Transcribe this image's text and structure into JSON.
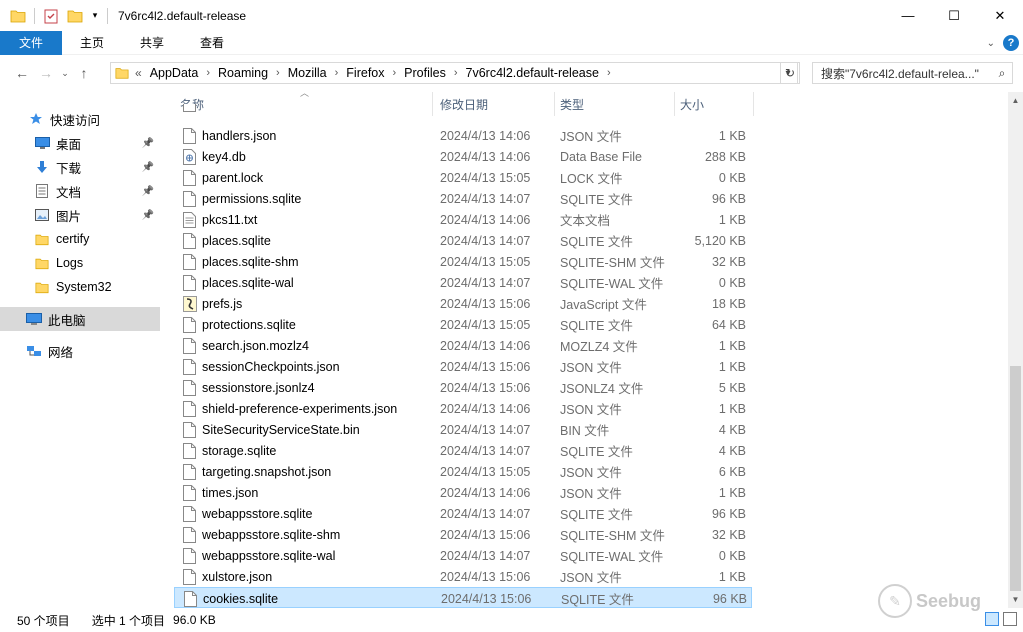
{
  "window": {
    "title": "7v6rc4l2.default-release",
    "minimize": "—",
    "maximize": "☐",
    "close": "✕"
  },
  "ribbon": {
    "tabs": [
      {
        "label": "文件"
      },
      {
        "label": "主页"
      },
      {
        "label": "共享"
      },
      {
        "label": "查看"
      }
    ],
    "help": "?"
  },
  "nav": {
    "breadcrumb": [
      "AppData",
      "Roaming",
      "Mozilla",
      "Firefox",
      "Profiles",
      "7v6rc4l2.default-release"
    ],
    "overflow": "«",
    "search_placeholder": "搜索\"7v6rc4l2.default-relea...\""
  },
  "sidebar": {
    "items": [
      {
        "label": "快速访问",
        "icon": "star-icon"
      },
      {
        "label": "桌面",
        "icon": "desktop-icon",
        "pinned": true
      },
      {
        "label": "下载",
        "icon": "download-icon",
        "pinned": true
      },
      {
        "label": "文档",
        "icon": "document-icon",
        "pinned": true
      },
      {
        "label": "图片",
        "icon": "pictures-icon",
        "pinned": true
      },
      {
        "label": "certify",
        "icon": "folder-icon"
      },
      {
        "label": "Logs",
        "icon": "folder-icon"
      },
      {
        "label": "System32",
        "icon": "folder-icon"
      },
      {
        "label": "此电脑",
        "icon": "computer-icon"
      },
      {
        "label": "网络",
        "icon": "network-icon"
      }
    ]
  },
  "columns": {
    "name": "名称",
    "date": "修改日期",
    "type": "类型",
    "size": "大小"
  },
  "files": [
    {
      "name": "handlers.json",
      "date": "2024/4/13 14:06",
      "type": "JSON 文件",
      "size": "1 KB",
      "icon": "file-icon"
    },
    {
      "name": "key4.db",
      "date": "2024/4/13 14:06",
      "type": "Data Base File",
      "size": "288 KB",
      "icon": "database-file-icon"
    },
    {
      "name": "parent.lock",
      "date": "2024/4/13 15:05",
      "type": "LOCK 文件",
      "size": "0 KB",
      "icon": "file-icon"
    },
    {
      "name": "permissions.sqlite",
      "date": "2024/4/13 14:07",
      "type": "SQLITE 文件",
      "size": "96 KB",
      "icon": "file-icon"
    },
    {
      "name": "pkcs11.txt",
      "date": "2024/4/13 14:06",
      "type": "文本文档",
      "size": "1 KB",
      "icon": "text-file-icon"
    },
    {
      "name": "places.sqlite",
      "date": "2024/4/13 14:07",
      "type": "SQLITE 文件",
      "size": "5,120 KB",
      "icon": "file-icon"
    },
    {
      "name": "places.sqlite-shm",
      "date": "2024/4/13 15:05",
      "type": "SQLITE-SHM 文件",
      "size": "32 KB",
      "icon": "file-icon"
    },
    {
      "name": "places.sqlite-wal",
      "date": "2024/4/13 14:07",
      "type": "SQLITE-WAL 文件",
      "size": "0 KB",
      "icon": "file-icon"
    },
    {
      "name": "prefs.js",
      "date": "2024/4/13 15:06",
      "type": "JavaScript 文件",
      "size": "18 KB",
      "icon": "javascript-file-icon"
    },
    {
      "name": "protections.sqlite",
      "date": "2024/4/13 15:05",
      "type": "SQLITE 文件",
      "size": "64 KB",
      "icon": "file-icon"
    },
    {
      "name": "search.json.mozlz4",
      "date": "2024/4/13 14:06",
      "type": "MOZLZ4 文件",
      "size": "1 KB",
      "icon": "file-icon"
    },
    {
      "name": "sessionCheckpoints.json",
      "date": "2024/4/13 15:06",
      "type": "JSON 文件",
      "size": "1 KB",
      "icon": "file-icon"
    },
    {
      "name": "sessionstore.jsonlz4",
      "date": "2024/4/13 15:06",
      "type": "JSONLZ4 文件",
      "size": "5 KB",
      "icon": "file-icon"
    },
    {
      "name": "shield-preference-experiments.json",
      "date": "2024/4/13 14:06",
      "type": "JSON 文件",
      "size": "1 KB",
      "icon": "file-icon"
    },
    {
      "name": "SiteSecurityServiceState.bin",
      "date": "2024/4/13 14:07",
      "type": "BIN 文件",
      "size": "4 KB",
      "icon": "file-icon"
    },
    {
      "name": "storage.sqlite",
      "date": "2024/4/13 14:07",
      "type": "SQLITE 文件",
      "size": "4 KB",
      "icon": "file-icon"
    },
    {
      "name": "targeting.snapshot.json",
      "date": "2024/4/13 15:05",
      "type": "JSON 文件",
      "size": "6 KB",
      "icon": "file-icon"
    },
    {
      "name": "times.json",
      "date": "2024/4/13 14:06",
      "type": "JSON 文件",
      "size": "1 KB",
      "icon": "file-icon"
    },
    {
      "name": "webappsstore.sqlite",
      "date": "2024/4/13 14:07",
      "type": "SQLITE 文件",
      "size": "96 KB",
      "icon": "file-icon"
    },
    {
      "name": "webappsstore.sqlite-shm",
      "date": "2024/4/13 15:06",
      "type": "SQLITE-SHM 文件",
      "size": "32 KB",
      "icon": "file-icon"
    },
    {
      "name": "webappsstore.sqlite-wal",
      "date": "2024/4/13 14:07",
      "type": "SQLITE-WAL 文件",
      "size": "0 KB",
      "icon": "file-icon"
    },
    {
      "name": "xulstore.json",
      "date": "2024/4/13 15:06",
      "type": "JSON 文件",
      "size": "1 KB",
      "icon": "file-icon"
    },
    {
      "name": "cookies.sqlite",
      "date": "2024/4/13 15:06",
      "type": "SQLITE 文件",
      "size": "96 KB",
      "icon": "file-icon",
      "selected": true
    }
  ],
  "status": {
    "count": "50 个项目",
    "selected": "选中 1 个项目",
    "size": "96.0 KB"
  },
  "watermark": "Seebug",
  "colors": {
    "accent": "#1979ca",
    "selection": "#cce8ff",
    "selection_border": "#99d1ff",
    "folder": "#ffd766"
  }
}
